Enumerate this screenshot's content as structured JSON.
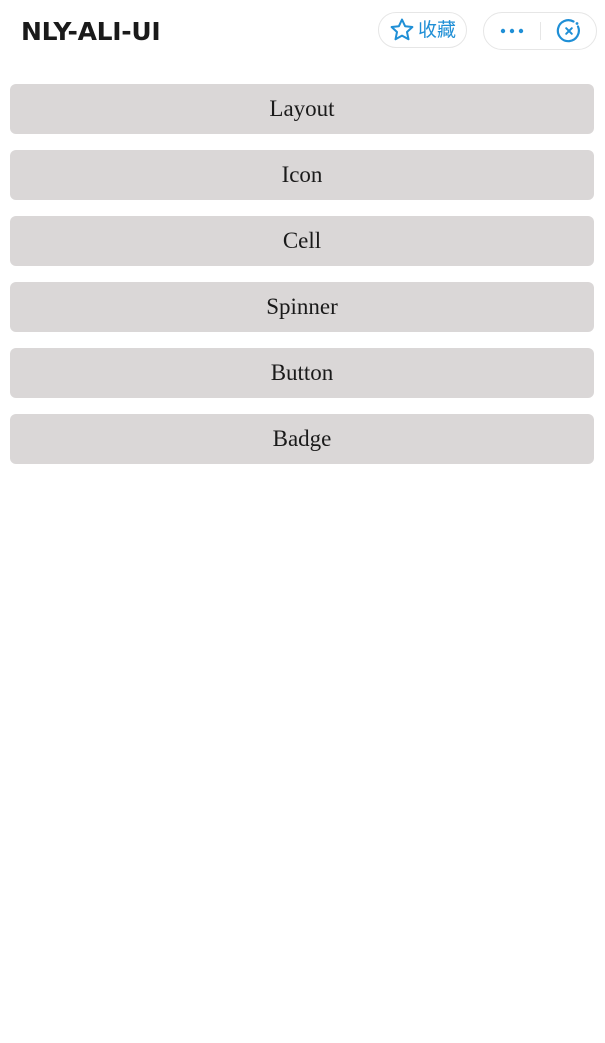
{
  "nav": {
    "title": "NLY-ALI-UI",
    "favorite_label": "收藏",
    "favorite_icon": "star-outline-icon",
    "more_icon": "more-dots-icon",
    "close_icon": "close-circle-icon",
    "accent_color": "#1f8fd6"
  },
  "menu": {
    "items": [
      {
        "label": "Layout"
      },
      {
        "label": "Icon"
      },
      {
        "label": "Cell"
      },
      {
        "label": "Spinner"
      },
      {
        "label": "Button"
      },
      {
        "label": "Badge"
      }
    ],
    "button_color": "#dad7d7"
  }
}
